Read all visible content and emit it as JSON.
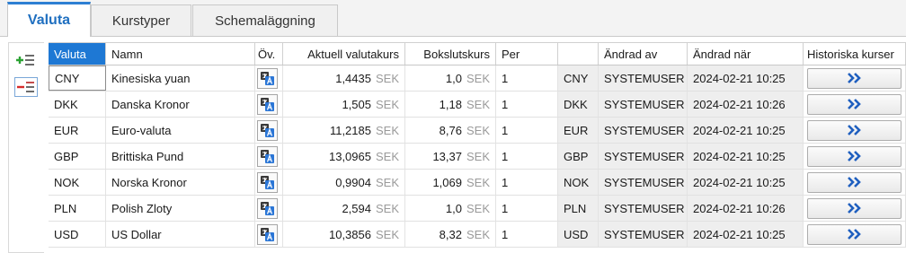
{
  "tabs": [
    {
      "label": "Valuta",
      "active": true
    },
    {
      "label": "Kurstyper",
      "active": false
    },
    {
      "label": "Schemaläggning",
      "active": false
    }
  ],
  "toolbar": {
    "add_icon": "add-row-icon",
    "remove_icon": "remove-row-icon"
  },
  "columns": [
    "Valuta",
    "Namn",
    "Öv.",
    "Aktuell valutakurs",
    "Bokslutskurs",
    "Per",
    "",
    "Ändrad av",
    "Ändrad när",
    "Historiska kurser"
  ],
  "unit_label": "SEK",
  "rows": [
    {
      "code": "CNY",
      "name": "Kinesiska yuan",
      "rate": "1,4435",
      "closing": "1,0",
      "per": "1",
      "code2": "CNY",
      "changed_by": "SYSTEMUSER",
      "changed_at": "2024-02-21 10:25"
    },
    {
      "code": "DKK",
      "name": "Danska Kronor",
      "rate": "1,505",
      "closing": "1,18",
      "per": "1",
      "code2": "DKK",
      "changed_by": "SYSTEMUSER",
      "changed_at": "2024-02-21 10:26"
    },
    {
      "code": "EUR",
      "name": "Euro-valuta",
      "rate": "11,2185",
      "closing": "8,76",
      "per": "1",
      "code2": "EUR",
      "changed_by": "SYSTEMUSER",
      "changed_at": "2024-02-21 10:25"
    },
    {
      "code": "GBP",
      "name": "Brittiska Pund",
      "rate": "13,0965",
      "closing": "13,37",
      "per": "1",
      "code2": "GBP",
      "changed_by": "SYSTEMUSER",
      "changed_at": "2024-02-21 10:25"
    },
    {
      "code": "NOK",
      "name": "Norska Kronor",
      "rate": "0,9904",
      "closing": "1,069",
      "per": "1",
      "code2": "NOK",
      "changed_by": "SYSTEMUSER",
      "changed_at": "2024-02-21 10:25"
    },
    {
      "code": "PLN",
      "name": "Polish Zloty",
      "rate": "2,594",
      "closing": "1,0",
      "per": "1",
      "code2": "PLN",
      "changed_by": "SYSTEMUSER",
      "changed_at": "2024-02-21 10:26"
    },
    {
      "code": "USD",
      "name": "US Dollar",
      "rate": "10,3856",
      "closing": "8,32",
      "per": "1",
      "code2": "USD",
      "changed_by": "SYSTEMUSER",
      "changed_at": "2024-02-21 10:25"
    }
  ],
  "colors": {
    "accent": "#1e78d4",
    "history_arrow": "#1f5fbf"
  }
}
